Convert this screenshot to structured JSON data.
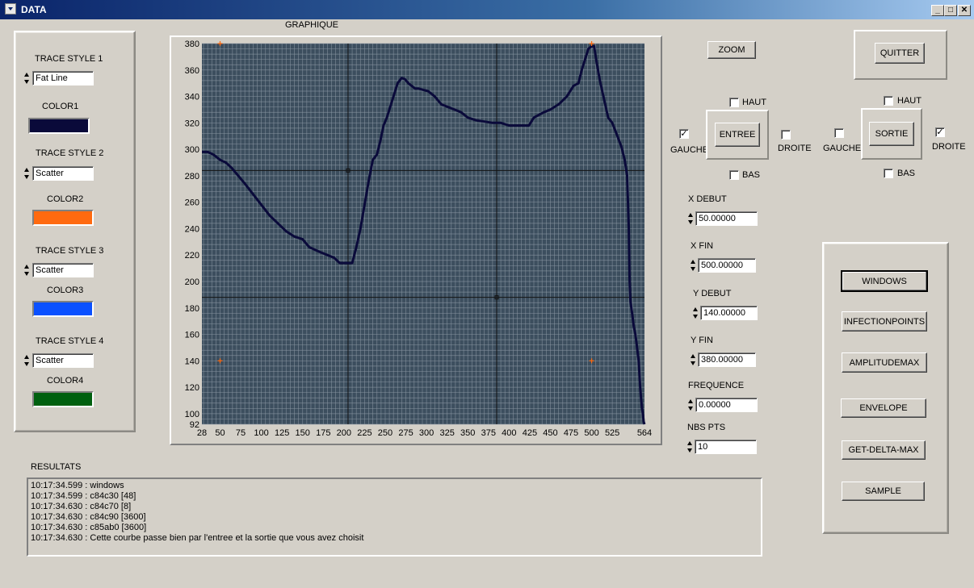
{
  "window": {
    "title": "DATA",
    "min": "_",
    "max": "□",
    "close": "✕"
  },
  "left_panel": {
    "traces": [
      {
        "style_label": "TRACE STYLE 1",
        "style_value": "Fat Line",
        "color_label": "COLOR1",
        "color": "#0a0a3a"
      },
      {
        "style_label": "TRACE STYLE 2",
        "style_value": "Scatter",
        "color_label": "COLOR2",
        "color": "#ff6a10"
      },
      {
        "style_label": "TRACE STYLE 3",
        "style_value": "Scatter",
        "color_label": "COLOR3",
        "color": "#0a50ff"
      },
      {
        "style_label": "TRACE STYLE 4",
        "style_value": "Scatter",
        "color_label": "COLOR4",
        "color": "#006010"
      }
    ]
  },
  "graph": {
    "title": "GRAPHIQUE"
  },
  "chart_data": {
    "type": "line",
    "title": "GRAPHIQUE",
    "xlim": [
      28,
      564
    ],
    "ylim": [
      92,
      380
    ],
    "x_ticks": [
      28,
      50,
      75,
      100,
      125,
      150,
      175,
      200,
      225,
      250,
      275,
      300,
      325,
      350,
      375,
      400,
      425,
      450,
      475,
      500,
      525,
      564
    ],
    "y_ticks": [
      92,
      100,
      120,
      140,
      160,
      180,
      200,
      220,
      240,
      260,
      280,
      300,
      320,
      340,
      360,
      380
    ],
    "grid": true,
    "background": "#3c4e5e",
    "cursors": [
      {
        "x": 205,
        "y": 284
      },
      {
        "x": 385,
        "y": 188
      }
    ],
    "markers": [
      {
        "x": 50,
        "y": 380
      },
      {
        "x": 500,
        "y": 380
      },
      {
        "x": 50,
        "y": 140
      },
      {
        "x": 500,
        "y": 140
      }
    ],
    "series": [
      {
        "x": [
          28,
          35,
          42,
          50,
          57,
          64,
          72,
          80,
          90,
          100,
          110,
          120,
          130,
          140,
          150,
          158,
          165,
          172,
          180,
          188,
          195,
          200,
          205,
          210,
          215,
          220,
          225,
          230,
          235,
          240,
          244,
          248,
          252,
          256,
          260,
          265,
          270,
          274,
          278,
          282,
          286,
          290,
          296,
          302,
          310,
          318,
          326,
          334,
          342,
          350,
          360,
          370,
          380,
          390,
          400,
          408,
          416,
          424,
          430,
          436,
          442,
          450,
          460,
          470,
          478,
          484,
          488,
          492,
          496,
          500,
          503,
          506,
          510,
          515,
          520,
          525,
          530,
          536,
          540,
          543,
          545,
          546,
          547,
          549,
          551,
          553,
          555,
          557,
          559,
          561,
          562,
          563,
          564
        ],
        "y": [
          298,
          298,
          296,
          292,
          290,
          286,
          280,
          274,
          266,
          258,
          250,
          244,
          238,
          234,
          232,
          226,
          224,
          222,
          220,
          218,
          214,
          214,
          214,
          214,
          226,
          240,
          258,
          276,
          292,
          296,
          306,
          318,
          324,
          332,
          340,
          350,
          354,
          353,
          350,
          348,
          346,
          346,
          345,
          344,
          340,
          334,
          332,
          330,
          328,
          324,
          322,
          321,
          320,
          320,
          318,
          318,
          318,
          318,
          324,
          326,
          328,
          330,
          334,
          340,
          348,
          350,
          360,
          368,
          376,
          378,
          378,
          366,
          352,
          338,
          324,
          320,
          312,
          302,
          292,
          280,
          240,
          200,
          185,
          176,
          166,
          160,
          150,
          140,
          118,
          104,
          100,
          94,
          92
        ]
      }
    ]
  },
  "controls": {
    "zoom": "ZOOM",
    "quitter": "QUITTER",
    "entree": "ENTREE",
    "sortie": "SORTIE",
    "haut": "HAUT",
    "bas": "BAS",
    "gauche": "GAUCHE",
    "droite": "DROITE",
    "entree_gauche_checked": "✓",
    "sortie_droite_checked": "✓"
  },
  "params": [
    {
      "label": "X DEBUT",
      "value": "50.00000"
    },
    {
      "label": "X FIN",
      "value": "500.00000"
    },
    {
      "label": "Y DEBUT",
      "value": "140.00000"
    },
    {
      "label": "Y FIN",
      "value": "380.00000"
    },
    {
      "label": "FREQUENCE",
      "value": "0.00000"
    },
    {
      "label": "NBS PTS",
      "value": "10"
    }
  ],
  "actions": [
    "WINDOWS",
    "INFECTIONPOINTS",
    "AMPLITUDEMAX",
    "ENVELOPE",
    "GET-DELTA-MAX",
    "SAMPLE"
  ],
  "results": {
    "label": "RESULTATS",
    "lines": [
      "10:17:34.599 : windows",
      "10:17:34.599 : c84c30 [48]",
      "10:17:34.630 : c84c70 [8]",
      "10:17:34.630 : c84c90 [3600]",
      "10:17:34.630 : c85ab0 [3600]",
      "10:17:34.630 : Cette courbe passe bien par l'entree et la sortie que vous avez choisit"
    ]
  }
}
